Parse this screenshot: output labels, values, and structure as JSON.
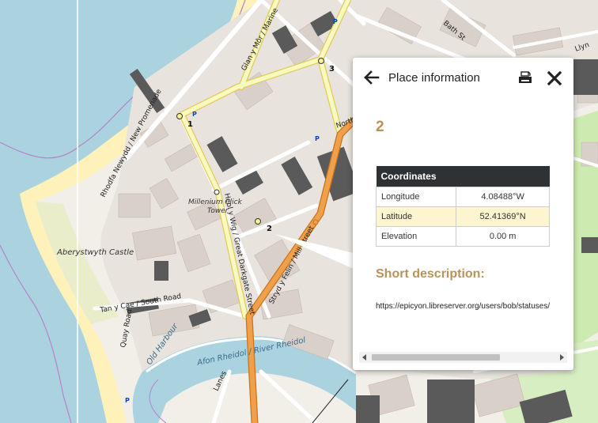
{
  "popup": {
    "title": "Place information",
    "place_name": "2",
    "coordinates_header": "Coordinates",
    "rows": [
      {
        "label": "Longitude",
        "value": "4.08488°W"
      },
      {
        "label": "Latitude",
        "value": "52.41369°N"
      },
      {
        "label": "Elevation",
        "value": "0.00 m"
      }
    ],
    "description_heading": "Short description:",
    "description_text": "https://epicyon.libreserver.org/users/bob/statuses/"
  },
  "map": {
    "markers": [
      {
        "label": "1"
      },
      {
        "label": "2"
      },
      {
        "label": "3"
      }
    ],
    "labels": {
      "castle": "Aberystwyth Castle",
      "clock_line1": "Millenium Click",
      "clock_line2": "Tower",
      "new_promenade": "Rhodfa Newydd / New Promenade",
      "marine": "Glan y Môr / Marine",
      "south_road": "Tan y Cae / South Road",
      "quay_road": "Quay Road",
      "great_darkgate": "Heol y Wig / Great Darkgate Street",
      "mill_street": "Stryd y Felin / Mill Street",
      "river": "Afon Rheidol / River Rheidol",
      "old_harbour": "Old Harbour",
      "north": "North",
      "llyn": "Llyn",
      "bath_st": "Bath St",
      "lanes": "Lanes"
    },
    "colors": {
      "sea": "#aad3df",
      "beach": "#fff1ba",
      "building": "#d9d0c9",
      "dark_building": "#5a5a5a",
      "primary_road": "#fcd6a4",
      "secondary_road": "#f7fabf",
      "trunk_road": "#e8912c",
      "park": "#cdebb0"
    }
  }
}
